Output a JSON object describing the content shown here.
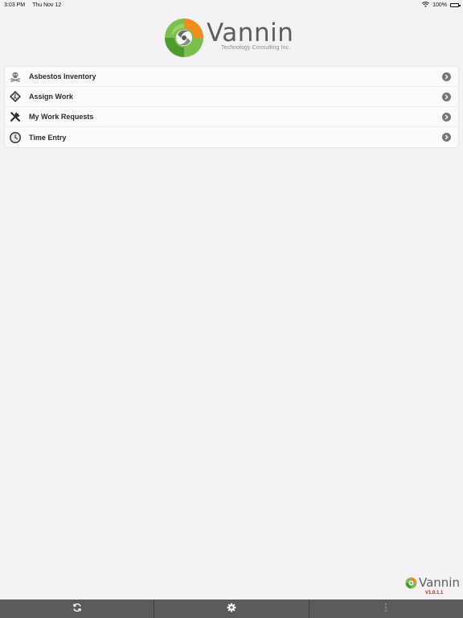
{
  "status_bar": {
    "time": "3:03 PM",
    "date": "Thu Nov 12",
    "battery": "100%",
    "wifi_icon": "wifi-icon",
    "battery_icon": "battery-icon"
  },
  "header": {
    "logo_name": "Vannin",
    "logo_tagline": "Technology Consulting Inc."
  },
  "menu": {
    "items": [
      {
        "label": "Asbestos Inventory",
        "icon": "skull-crossbones-icon"
      },
      {
        "label": "Assign Work",
        "icon": "road-sign-icon"
      },
      {
        "label": "My Work Requests",
        "icon": "tools-icon"
      },
      {
        "label": "Time Entry",
        "icon": "clock-icon"
      }
    ],
    "chevron_icon": "chevron-right-circle-icon"
  },
  "footer": {
    "logo_name": "Vannin",
    "version": "V1.0.1.1"
  },
  "toolbar": {
    "buttons": [
      {
        "icon": "refresh-icon"
      },
      {
        "icon": "gear-icon"
      },
      {
        "icon": "more-vertical-icon"
      }
    ]
  },
  "colors": {
    "background": "#f4f2f4",
    "toolbar": "#5b5b5b",
    "logo_green": "#6ab04c",
    "logo_orange": "#f28c1e",
    "version_red": "#b3261e"
  }
}
